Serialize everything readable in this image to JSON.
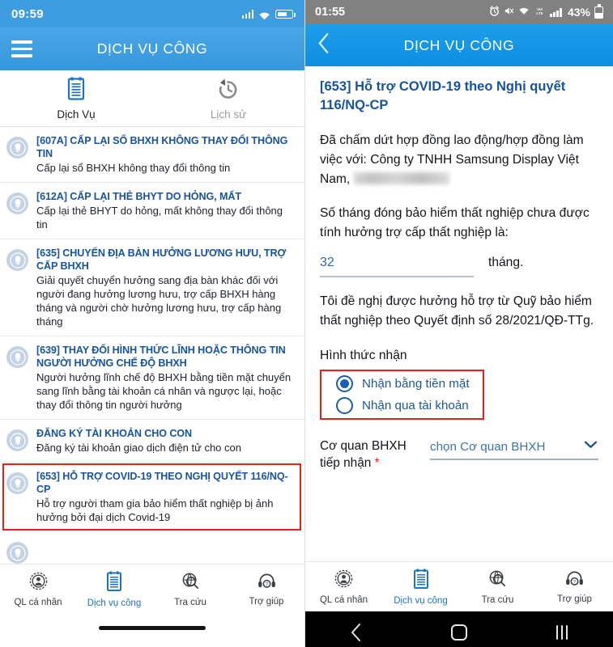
{
  "left": {
    "status": {
      "time": "09:59",
      "icons": [
        "signal-bars-icon",
        "wifi-icon",
        "battery-icon"
      ]
    },
    "appbar": {
      "title": "DỊCH VỤ CÔNG",
      "menu_icon": "hamburger-menu-icon"
    },
    "tabs": [
      {
        "label": "Dịch Vụ",
        "icon": "document-icon",
        "active": true
      },
      {
        "label": "Lịch sử",
        "icon": "history-icon",
        "active": false
      }
    ],
    "services": [
      {
        "title": "[607A] CẤP LẠI SỔ BHXH KHÔNG THAY ĐỔI THÔNG TIN",
        "desc": "Cấp lại sổ BHXH không thay đổi thông tin",
        "highlighted": false
      },
      {
        "title": "[612A] CẤP LẠI THẺ BHYT DO HỎNG, MẤT",
        "desc": "Cấp lại thẻ BHYT do hỏng, mất không thay đổi thông tin",
        "highlighted": false
      },
      {
        "title": "[635] CHUYỂN ĐỊA BÀN HƯỞNG LƯƠNG HƯU, TRỢ CẤP BHXH",
        "desc": "Giải quyết chuyển hưởng sang địa bàn khác đối với người đang hưởng lương hưu, trợ cấp BHXH hàng tháng và người chờ hưởng lương hưu, trợ cấp hàng tháng",
        "highlighted": false
      },
      {
        "title": "[639] THAY ĐỔI HÌNH THỨC LĨNH HOẶC THÔNG TIN NGƯỜI HƯỞNG CHẾ ĐỘ BHXH",
        "desc": "Người hưởng lĩnh chế độ BHXH bằng tiền mặt chuyển sang lĩnh bằng tài khoản cá nhân và ngược lại, hoặc thay đổi thông tin người hưởng",
        "highlighted": false
      },
      {
        "title": "ĐĂNG KÝ TÀI KHOẢN CHO CON",
        "desc": "Đăng ký tài khoản giao dịch điện tử cho con",
        "highlighted": false
      },
      {
        "title": "[653] HỖ TRỢ COVID-19 THEO NGHỊ QUYẾT 116/NQ-CP",
        "desc": "Hỗ trợ người tham gia bảo hiểm thất nghiệp bị ảnh hưởng bởi đại dịch Covid-19",
        "highlighted": true
      }
    ],
    "bottom_nav": [
      {
        "label": "QL cá nhân",
        "icon": "personal-account-icon",
        "active": false
      },
      {
        "label": "Dịch vụ công",
        "icon": "document-icon",
        "active": true
      },
      {
        "label": "Tra cứu",
        "icon": "search-globe-icon",
        "active": false
      },
      {
        "label": "Trợ giúp",
        "icon": "headset-help-icon",
        "active": false
      }
    ]
  },
  "right": {
    "status": {
      "time": "01:55",
      "battery_pct": "43%",
      "icons": [
        "alarm-icon",
        "mute-icon",
        "wifi-icon",
        "volte-icon",
        "signal-bars-icon",
        "battery-icon"
      ],
      "volte_label": "VoLTE"
    },
    "appbar": {
      "title": "DỊCH VỤ CÔNG",
      "back_icon": "chevron-left-icon"
    },
    "form": {
      "doc_title": "[653] Hỗ trợ COVID-19 theo Nghị quyết 116/NQ-CP",
      "paragraph_1_prefix": "Đã chấm dứt hợp đồng  lao động/hợp đồng làm việc với: Công ty TNHH Samsung Display Việt Nam,",
      "paragraph_1_redacted": "redacted-text",
      "months_question": "Số tháng đóng bảo hiểm thất nghiệp chưa được tính hưởng trợ cấp thất nghiệp là:",
      "months_value": "32",
      "months_unit": "tháng.",
      "paragraph_2": "Tôi đề nghị được hưởng hỗ trợ từ Quỹ bảo hiểm thất nghiệp theo Quyết định số 28/2021/QĐ-TTg.",
      "receive_method_label": "Hình thức nhận",
      "receive_options": [
        {
          "label": "Nhận bằng tiền mặt",
          "selected": true
        },
        {
          "label": "Nhận qua tài khoản",
          "selected": false
        }
      ],
      "agency_label": "Cơ quan BHXH tiếp nhận",
      "agency_required_mark": "*",
      "agency_placeholder": "chọn Cơ quan BHXH",
      "agency_chevron": "chevron-down-icon"
    },
    "bottom_nav": [
      {
        "label": "QL cá nhân",
        "icon": "personal-account-icon",
        "active": false
      },
      {
        "label": "Dịch vụ công",
        "icon": "document-icon",
        "active": true
      },
      {
        "label": "Tra cứu",
        "icon": "search-globe-icon",
        "active": false
      },
      {
        "label": "Trợ giúp",
        "icon": "headset-help-icon",
        "active": false
      }
    ],
    "android_nav": [
      {
        "icon": "android-back-icon"
      },
      {
        "icon": "android-home-icon"
      },
      {
        "icon": "android-recents-icon"
      }
    ]
  },
  "colors": {
    "left_header_blue": "#3e9ce0",
    "right_header_blue": "#0c8ee4",
    "title_blue": "#17539e",
    "highlight_red": "#e8201a",
    "status_grey": "#818181"
  }
}
